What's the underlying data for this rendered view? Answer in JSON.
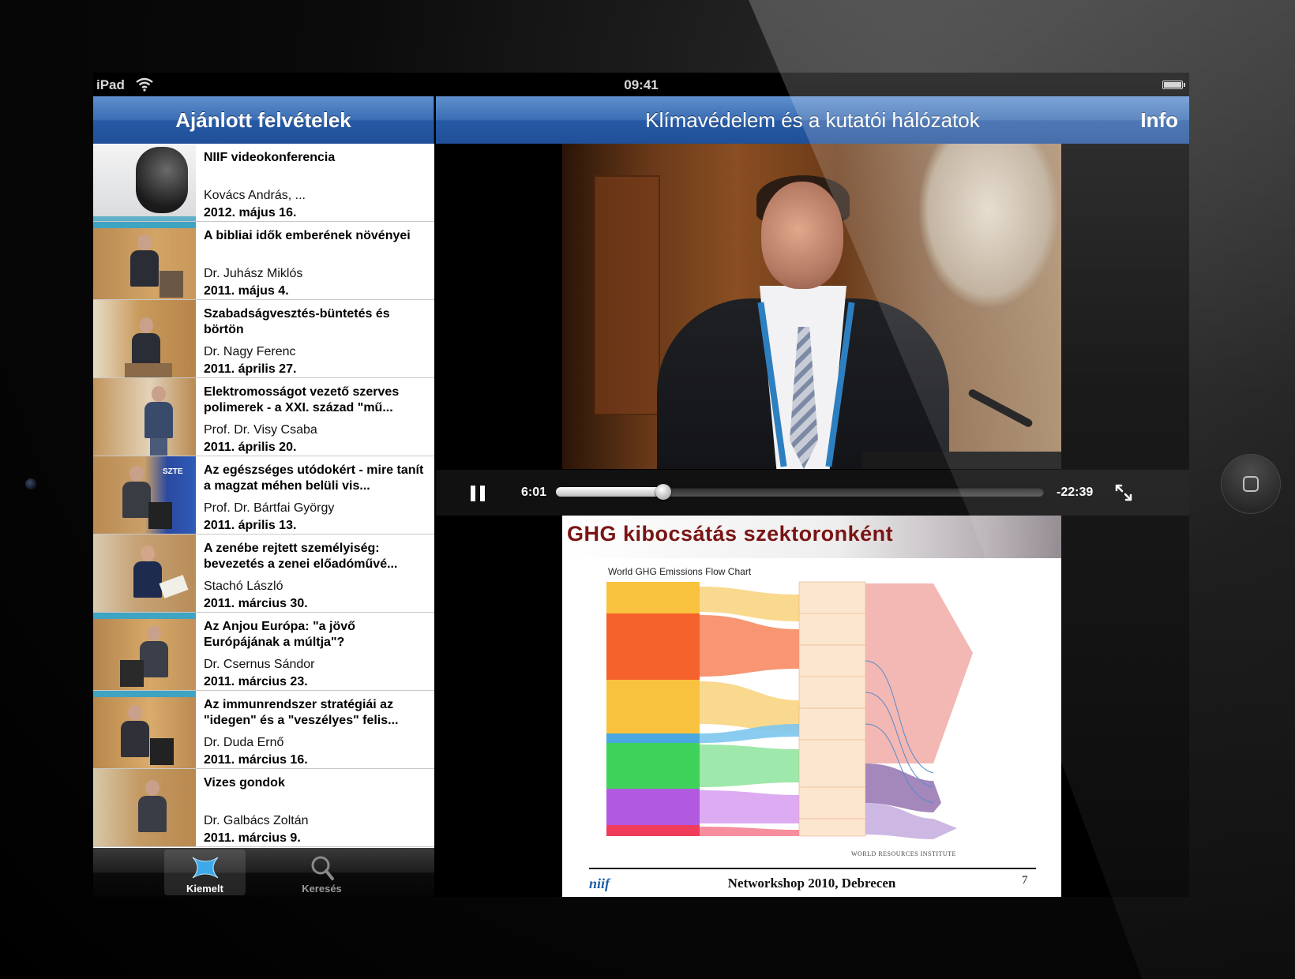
{
  "status_bar": {
    "device": "iPad",
    "time": "09:41"
  },
  "left_nav": {
    "title": "Ajánlott felvételek"
  },
  "items": [
    {
      "title": "NIIF videokonferencia",
      "author": "Kovács András, ...",
      "date": "2012. május 16."
    },
    {
      "title": "A bibliai idők emberének növényei",
      "author": "Dr. Juhász Miklós",
      "date": "2011. május  4."
    },
    {
      "title": "Szabadságvesztés-büntetés és börtön",
      "author": "Dr. Nagy Ferenc",
      "date": "2011. április 27."
    },
    {
      "title": "Elektromosságot vezető szerves polimerek - a XXI. század \"mű...",
      "author": "Prof. Dr. Visy Csaba",
      "date": "2011. április 20."
    },
    {
      "title": "Az egészséges utódokért - mire tanít a magzat méhen belüli vis...",
      "author": "Prof. Dr. Bártfai György",
      "date": "2011. április 13."
    },
    {
      "title": "A zenébe rejtett személyiség: bevezetés a zenei előadóművé...",
      "author": "Stachó László",
      "date": "2011. március 30."
    },
    {
      "title": "Az Anjou Európa: \"a jövő Európájának a múltja\"?",
      "author": "Dr. Csernus Sándor",
      "date": "2011. március 23."
    },
    {
      "title": "Az immunrendszer stratégiái az \"idegen\" és a \"veszélyes\" felis...",
      "author": "Dr. Duda Ernő",
      "date": "2011. március 16."
    },
    {
      "title": "Vizes gondok",
      "author": "Dr. Galbács Zoltán",
      "date": "2011. március  9."
    }
  ],
  "tabs": [
    {
      "label": "Kiemelt",
      "icon": "featured-x-icon",
      "active": true
    },
    {
      "label": "Keresés",
      "icon": "search-icon",
      "active": false
    }
  ],
  "right_nav": {
    "title": "Klímavédelem és a kutatói hálózatok",
    "info_label": "Info"
  },
  "player": {
    "elapsed": "6:01",
    "remaining": "-22:39",
    "progress_fraction": 0.22
  },
  "slide": {
    "title": "GHG kibocsátás szektoronként",
    "chart_title": "World GHG Emissions Flow Chart",
    "footer": "Networkshop 2010, Debrecen",
    "page": "7",
    "logo": "niif",
    "source": "WORLD RESOURCES INSTITUTE"
  },
  "colors": {
    "nav_blue": "#275aa5",
    "energy_orange": "#f5622c",
    "energy_yellow": "#f8c23e",
    "land_green": "#3fd25a",
    "agri_purple": "#b15ae0",
    "gas_pink": "#f2b4b0",
    "title_red": "#7a1414"
  }
}
